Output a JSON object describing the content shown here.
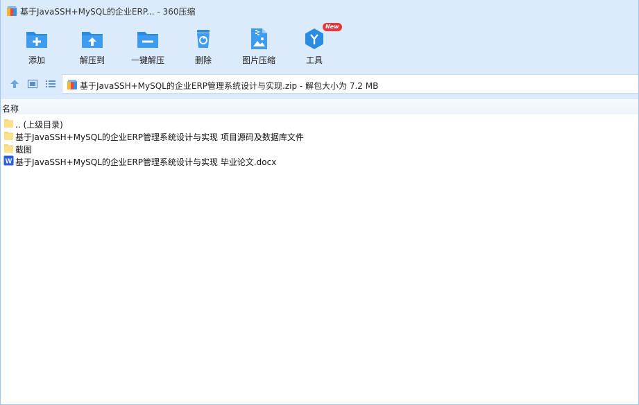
{
  "window": {
    "title": "基于JavaSSH+MySQL的企业ERP... - 360压缩"
  },
  "toolbar": {
    "items": [
      {
        "label": "添加",
        "icon": "add-icon"
      },
      {
        "label": "解压到",
        "icon": "extract-to-icon"
      },
      {
        "label": "一键解压",
        "icon": "one-click-extract-icon"
      },
      {
        "label": "删除",
        "icon": "delete-icon"
      },
      {
        "label": "图片压缩",
        "icon": "image-compress-icon"
      },
      {
        "label": "工具",
        "icon": "tools-icon"
      }
    ],
    "new_badge": "New"
  },
  "address": {
    "text": "基于JavaSSH+MySQL的企业ERP管理系统设计与实现.zip - 解包大小为 7.2 MB"
  },
  "list": {
    "column_name": "名称",
    "rows": [
      {
        "name": ".. (上级目录)",
        "type": "folder"
      },
      {
        "name": "基于JavaSSH+MySQL的企业ERP管理系统设计与实现 项目源码及数据库文件",
        "type": "folder"
      },
      {
        "name": "截图",
        "type": "folder"
      },
      {
        "name": "基于JavaSSH+MySQL的企业ERP管理系统设计与实现 毕业论文.docx",
        "type": "word"
      }
    ]
  },
  "colors": {
    "accent": "#2b8be0",
    "top_bg": "#dcebfb",
    "folder": "#f8d775",
    "word": "#2b5fd9",
    "badge": "#e8343b"
  }
}
